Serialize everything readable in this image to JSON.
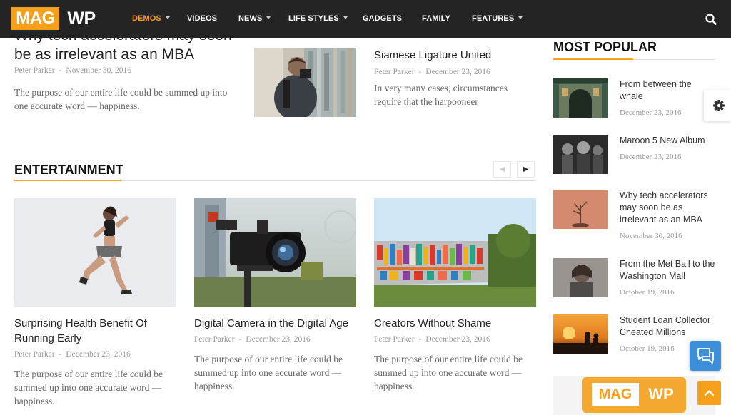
{
  "header": {
    "logo": {
      "part1": "MAG",
      "part2": "WP"
    },
    "nav": [
      {
        "label": "DEMOS",
        "dropdown": true,
        "active": true
      },
      {
        "label": "VIDEOS",
        "dropdown": false,
        "active": false
      },
      {
        "label": "NEWS",
        "dropdown": true,
        "active": false
      },
      {
        "label": "LIFE STYLES",
        "dropdown": true,
        "active": false
      },
      {
        "label": "GADGETS",
        "dropdown": false,
        "active": false
      },
      {
        "label": "FAMILY",
        "dropdown": false,
        "active": false
      },
      {
        "label": "FEATURES",
        "dropdown": true,
        "active": false
      }
    ],
    "search_icon": "search-icon"
  },
  "top_articles": [
    {
      "title": "Why tech accelerators may soon be as irrelevant as an MBA",
      "author": "Peter Parker",
      "separator": "-",
      "date": "November 30, 2016",
      "excerpt": "The purpose of our entire life could be summed up into one accurate word — happiness."
    },
    {
      "title": "Siamese Ligature United",
      "author": "Peter Parker",
      "separator": "-",
      "date": "December 23, 2016",
      "excerpt": "In very many cases, circumstances require that the harpooneer"
    }
  ],
  "entertainment": {
    "title": "ENTERTAINMENT",
    "prev_icon": "chevron-left-icon",
    "next_icon": "chevron-right-icon",
    "cards": [
      {
        "title": "Surprising Health Benefit Of Running Early",
        "author": "Peter Parker",
        "separator": "-",
        "date": "December 23, 2016",
        "excerpt": "The purpose of our entire life could be summed up into one accurate word — happiness."
      },
      {
        "title": "Digital Camera in the Digital Age",
        "author": "Peter Parker",
        "separator": "-",
        "date": "December 23, 2016",
        "excerpt": "The purpose of our entire life could be summed up into one accurate word — happiness."
      },
      {
        "title": "Creators Without Shame",
        "author": "Peter Parker",
        "separator": "-",
        "date": "December 23, 2016",
        "excerpt": "The purpose of our entire life could be summed up into one accurate word — happiness."
      }
    ]
  },
  "sidebar": {
    "title": "MOST POPULAR",
    "items": [
      {
        "title": "From between the whale",
        "date": "December 23, 2016"
      },
      {
        "title": "Maroon 5 New Album",
        "date": "December 23, 2016"
      },
      {
        "title": "Why tech accelerators may soon be as irrelevant as an MBA",
        "date": "November 30, 2016"
      },
      {
        "title": "From the Met Ball to the Washington Mall",
        "date": "October 19, 2016"
      },
      {
        "title": "Student Loan Collector Cheated Millions",
        "date": "October 19, 2016"
      }
    ],
    "ad_logo": {
      "part1": "MAG",
      "part2": "WP"
    }
  },
  "floating": {
    "settings_icon": "gear-icon",
    "chat_icon": "chat-icon",
    "scroll_top_icon": "arrow-up-icon"
  },
  "colors": {
    "accent": "#f5a01a",
    "header_bg": "#242424",
    "chat_blue": "#3d8fd9"
  }
}
